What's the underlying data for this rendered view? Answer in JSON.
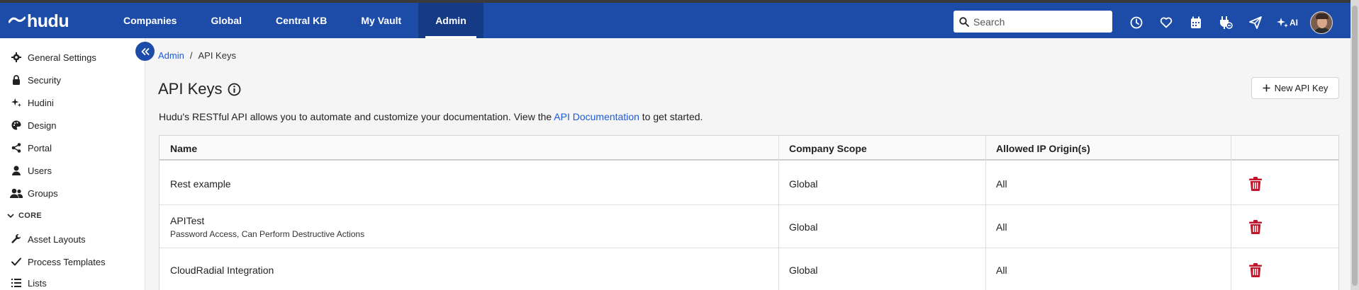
{
  "app": {
    "logo_text": "hudu"
  },
  "nav": {
    "items": [
      {
        "label": "Companies"
      },
      {
        "label": "Global"
      },
      {
        "label": "Central KB"
      },
      {
        "label": "My Vault"
      },
      {
        "label": "Admin",
        "active": true
      }
    ]
  },
  "search": {
    "placeholder": "Search"
  },
  "toolbar": {
    "icons": [
      "clock-icon",
      "heart-icon",
      "calendar-icon",
      "plug-icon",
      "paper-plane-icon"
    ],
    "ai_label": "AI"
  },
  "sidebar": {
    "items": [
      {
        "label": "General Settings",
        "icon": "gear-icon"
      },
      {
        "label": "Security",
        "icon": "lock-icon"
      },
      {
        "label": "Hudini",
        "icon": "sparkles-icon"
      },
      {
        "label": "Design",
        "icon": "palette-icon"
      },
      {
        "label": "Portal",
        "icon": "share-icon"
      },
      {
        "label": "Users",
        "icon": "user-icon"
      },
      {
        "label": "Groups",
        "icon": "users-icon"
      }
    ],
    "section_core": "CORE",
    "core_items": [
      {
        "label": "Asset Layouts",
        "icon": "wrench-icon"
      },
      {
        "label": "Process Templates",
        "icon": "check-icon"
      },
      {
        "label": "Lists",
        "icon": "list-icon"
      }
    ]
  },
  "breadcrumb": {
    "parent": "Admin",
    "separator": "/",
    "current": "API Keys"
  },
  "page": {
    "title": "API Keys",
    "new_button": "New API Key",
    "description_before": "Hudu's RESTful API allows you to automate and customize your documentation. View the ",
    "description_link": "API Documentation",
    "description_after": " to get started."
  },
  "table": {
    "columns": [
      "Name",
      "Company Scope",
      "Allowed IP Origin(s)",
      ""
    ],
    "rows": [
      {
        "name": "Rest example",
        "sub": "",
        "scope": "Global",
        "ips": "All"
      },
      {
        "name": "APITest",
        "sub": "Password Access, Can Perform Destructive Actions",
        "scope": "Global",
        "ips": "All"
      },
      {
        "name": "CloudRadial Integration",
        "sub": "",
        "scope": "Global",
        "ips": "All"
      }
    ]
  },
  "colors": {
    "nav_bg": "#1d4ba8",
    "link": "#1d5bd8",
    "danger": "#c0152a"
  }
}
